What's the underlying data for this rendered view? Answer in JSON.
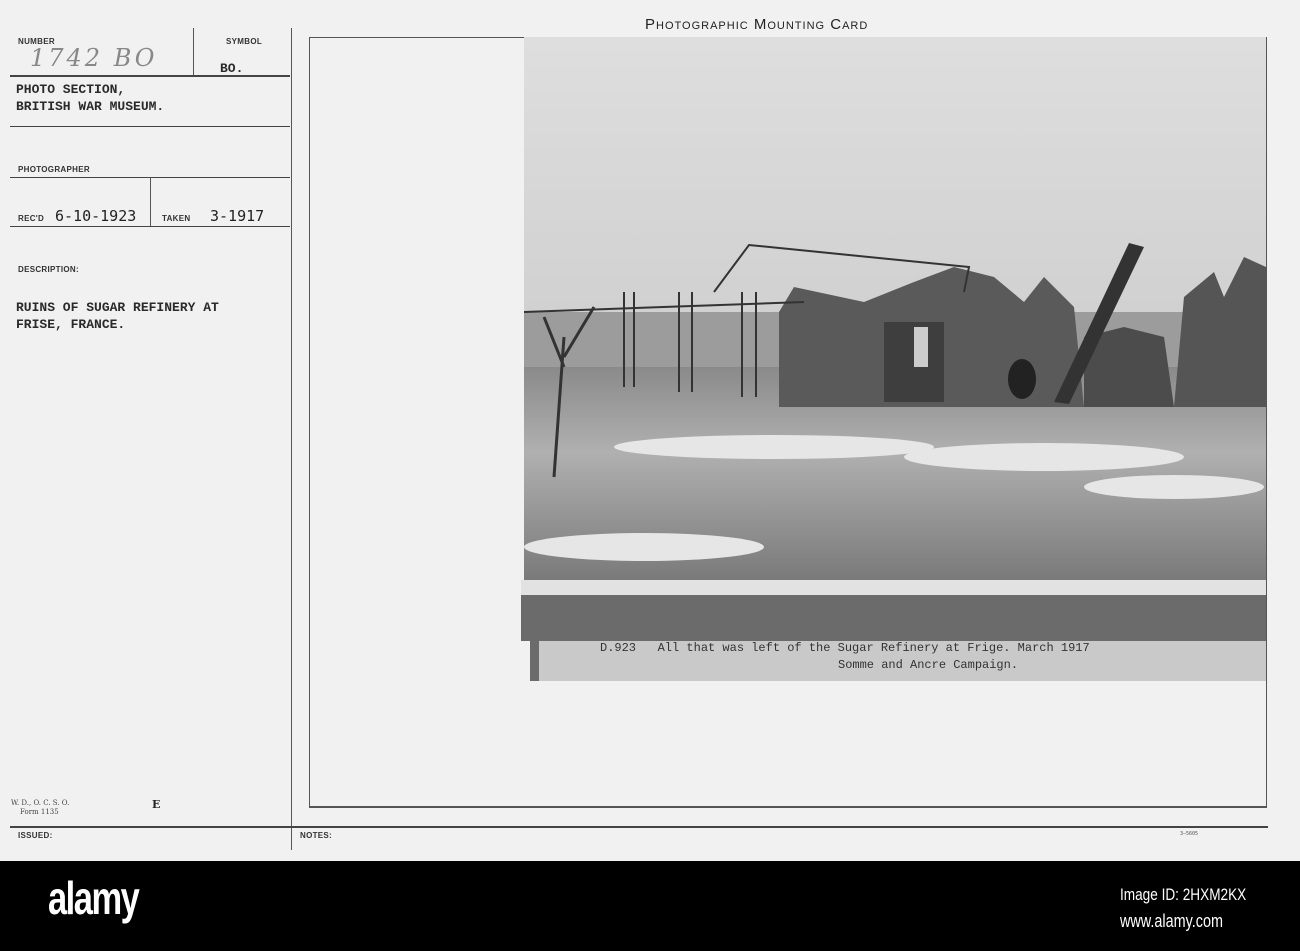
{
  "card": {
    "title": "Photographic Mounting Card",
    "number_label": "NUMBER",
    "number_value": "1742 BO",
    "symbol_label": "SYMBOL",
    "symbol_value": "BO.",
    "section_line1": "PHOTO SECTION,",
    "section_line2": "BRITISH WAR MUSEUM.",
    "photographer_label": "PHOTOGRAPHER",
    "recd_label": "REC'D",
    "recd_value": "6-10-1923",
    "taken_label": "TAKEN",
    "taken_value": "3-1917",
    "description_label": "DESCRIPTION:",
    "description_line1": "RUINS OF SUGAR REFINERY AT",
    "description_line2": "FRISE, FRANCE.",
    "form_line1": "W. D., O. C. S. O.",
    "form_line2": "Form 1135",
    "form_mark": "E",
    "issued_label": "ISSUED:",
    "notes_label": "NOTES:",
    "print_code": "3—5605"
  },
  "photo": {
    "caption_line1": "D.923   All that was left of the Sugar Refinery at Frige. March 1917",
    "caption_line2": "Somme and Ancre Campaign."
  },
  "footer": {
    "logo": "alamy",
    "image_id": "Image ID: 2HXM2KX",
    "url": "www.alamy.com"
  }
}
